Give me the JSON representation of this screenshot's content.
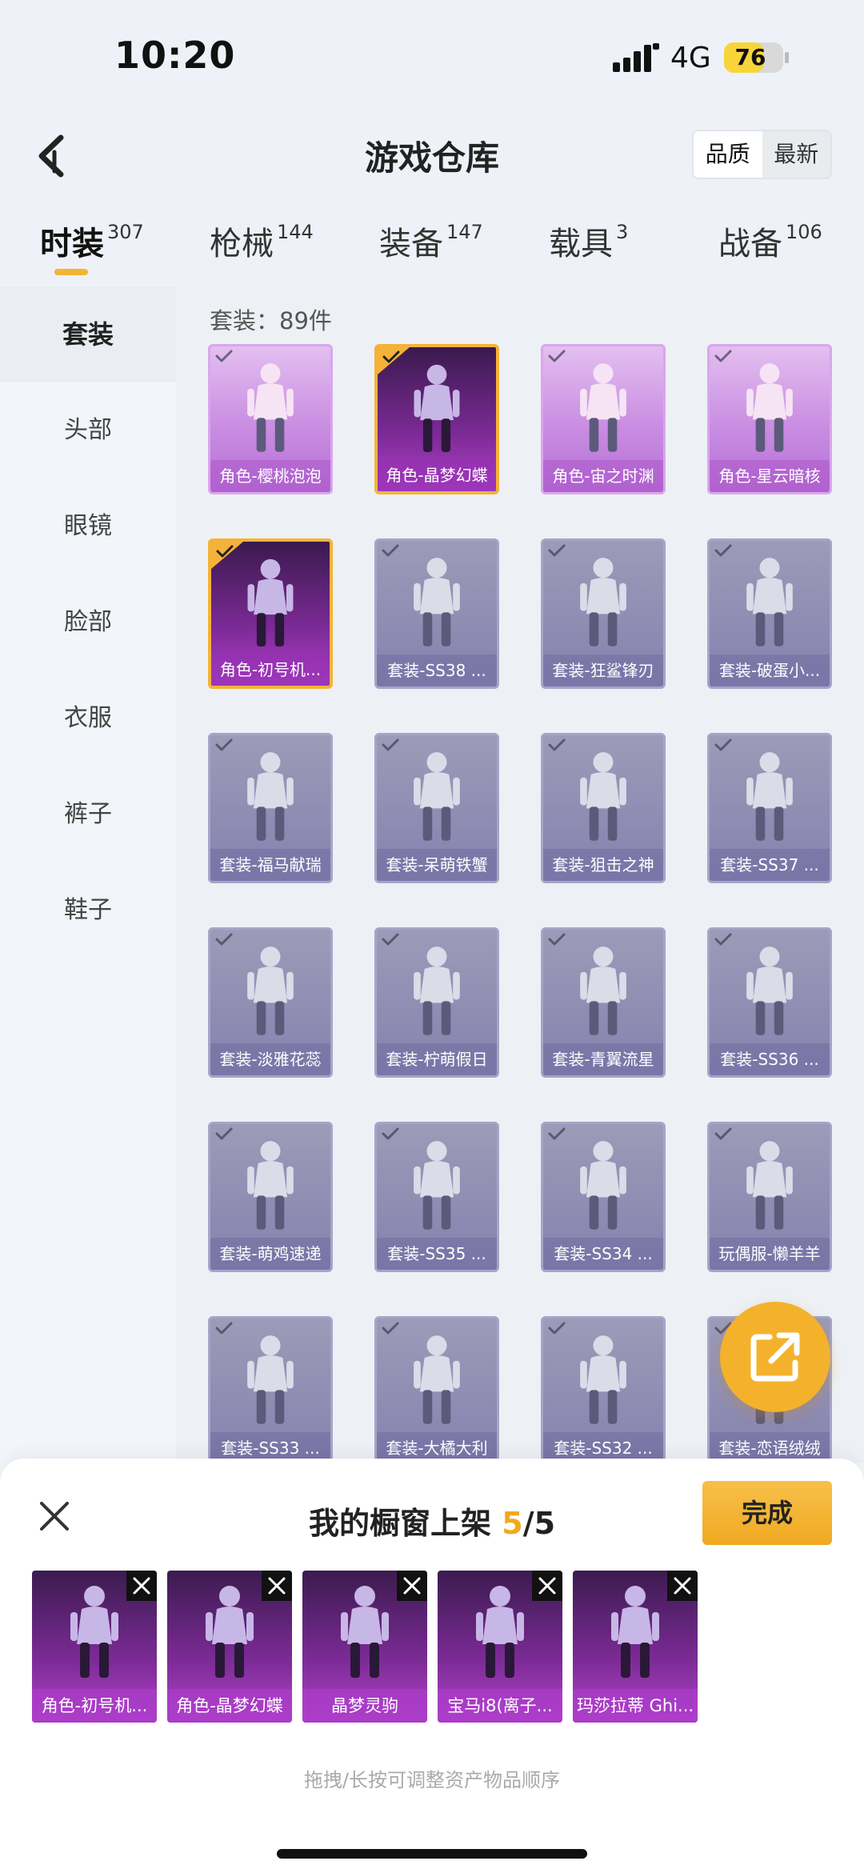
{
  "status": {
    "time": "10:20",
    "network": "4G",
    "battery": "76",
    "battery_level": 0.76
  },
  "header": {
    "title": "游戏仓库",
    "sort_options": [
      "品质",
      "最新"
    ],
    "active_sort": 0
  },
  "tabs": [
    {
      "label": "时装",
      "count": "307"
    },
    {
      "label": "枪械",
      "count": "144"
    },
    {
      "label": "装备",
      "count": "147"
    },
    {
      "label": "载具",
      "count": "3"
    },
    {
      "label": "战备",
      "count": "106"
    }
  ],
  "sidebar": {
    "items": [
      "套装",
      "头部",
      "眼镜",
      "脸部",
      "衣服",
      "裤子",
      "鞋子"
    ]
  },
  "grid": {
    "count_label": "套装：89件",
    "items": [
      {
        "label": "角色-樱桃泡泡",
        "kind": "role",
        "selected": false
      },
      {
        "label": "角色-晶梦幻蝶",
        "kind": "sel",
        "selected": true
      },
      {
        "label": "角色-宙之时渊",
        "kind": "role",
        "selected": false
      },
      {
        "label": "角色-星云暗核",
        "kind": "role",
        "selected": false
      },
      {
        "label": "角色-初号机...",
        "kind": "sel",
        "selected": true
      },
      {
        "label": "套装-SS38 ...",
        "kind": "suit",
        "selected": false
      },
      {
        "label": "套装-狂鲨锋刃",
        "kind": "suit",
        "selected": false
      },
      {
        "label": "套装-破蛋小...",
        "kind": "suit",
        "selected": false
      },
      {
        "label": "套装-福马献瑞",
        "kind": "suit",
        "selected": false
      },
      {
        "label": "套装-呆萌铁蟹",
        "kind": "suit",
        "selected": false
      },
      {
        "label": "套装-狙击之神",
        "kind": "suit",
        "selected": false
      },
      {
        "label": "套装-SS37 ...",
        "kind": "suit",
        "selected": false
      },
      {
        "label": "套装-淡雅花蕊",
        "kind": "suit",
        "selected": false
      },
      {
        "label": "套装-柠萌假日",
        "kind": "suit",
        "selected": false
      },
      {
        "label": "套装-青翼流星",
        "kind": "suit",
        "selected": false
      },
      {
        "label": "套装-SS36 ...",
        "kind": "suit",
        "selected": false
      },
      {
        "label": "套装-萌鸡速递",
        "kind": "suit",
        "selected": false
      },
      {
        "label": "套装-SS35 ...",
        "kind": "suit",
        "selected": false
      },
      {
        "label": "套装-SS34 ...",
        "kind": "suit",
        "selected": false
      },
      {
        "label": "玩偶服-懒羊羊",
        "kind": "suit",
        "selected": false
      },
      {
        "label": "套装-SS33 ...",
        "kind": "suit",
        "selected": false
      },
      {
        "label": "套装-大橘大利",
        "kind": "suit",
        "selected": false
      },
      {
        "label": "套装-SS32 ...",
        "kind": "suit",
        "selected": false
      },
      {
        "label": "套装-恋语绒绒",
        "kind": "suit",
        "selected": false
      }
    ]
  },
  "sheet": {
    "title": "我的橱窗上架",
    "current": "5",
    "total": "/5",
    "done_label": "完成",
    "hint": "拖拽/长按可调整资产物品顺序",
    "slots": [
      {
        "label": "角色-初号机..."
      },
      {
        "label": "角色-晶梦幻蝶"
      },
      {
        "label": "晶梦灵驹"
      },
      {
        "label": "宝马i8(离子..."
      },
      {
        "label": "玛莎拉蒂 Ghi..."
      }
    ]
  },
  "icons": {
    "back": "chevron-left-icon",
    "check": "check-icon",
    "share": "share-icon",
    "close": "close-icon",
    "remove": "remove-icon"
  },
  "colors": {
    "accent": "#f4b22c",
    "selected_border": "#f4b338"
  }
}
